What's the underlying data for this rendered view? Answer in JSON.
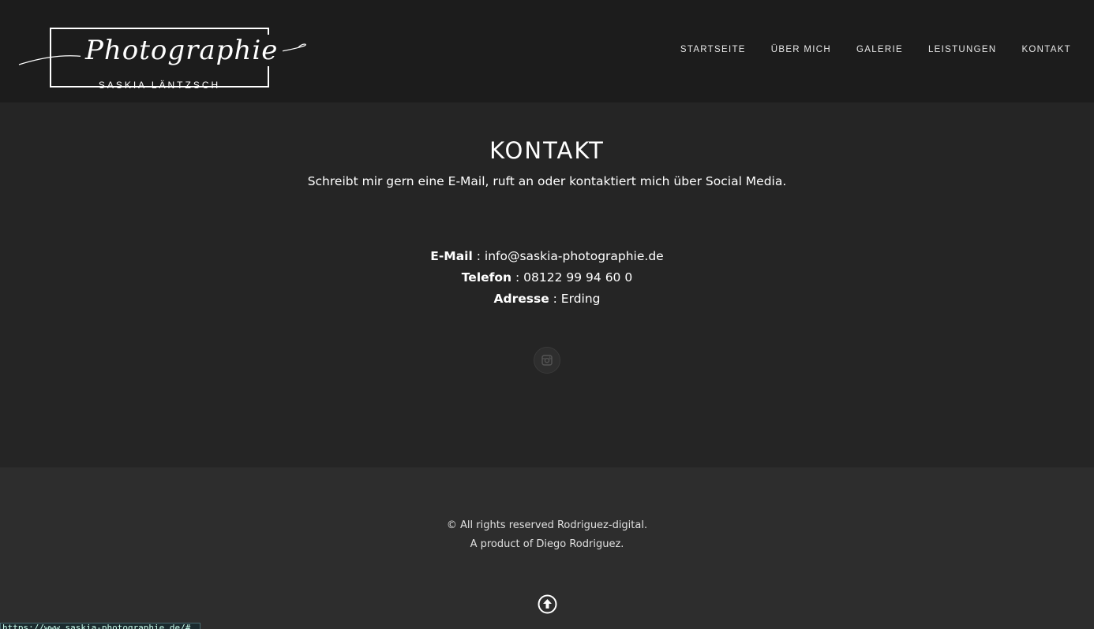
{
  "header": {
    "logo_script": "Photographie",
    "logo_sub": "SASKIA LÄNTZSCH",
    "nav": [
      {
        "label": "STARTSEITE"
      },
      {
        "label": "ÜBER MICH"
      },
      {
        "label": "GALERIE"
      },
      {
        "label": "LEISTUNGEN"
      },
      {
        "label": "KONTAKT"
      }
    ]
  },
  "main": {
    "title": "KONTAKT",
    "subtitle": "Schreibt mir gern eine E-Mail, ruft an oder kontaktiert mich über Social Media.",
    "contact": {
      "email_label": "E-Mail",
      "email_value": "info@saskia-photographie.de",
      "phone_label": "Telefon",
      "phone_value": "08122 99 94 60 0",
      "address_label": "Adresse",
      "address_value": "Erding",
      "separator": " : "
    },
    "social_icon": "instagram-icon"
  },
  "footer": {
    "copyright": "© All rights reserved Rodriguez-digital.",
    "product": "A product of Diego Rodriguez.",
    "to_top_icon": "arrow-up-circle-icon"
  },
  "status_bar": {
    "url": "https://www.saskia-photographie.de/#"
  },
  "colors": {
    "header_bg": "#1c1c1c",
    "main_bg": "#252525",
    "footer_bg": "#2d2d2d",
    "text": "#ffffff"
  }
}
